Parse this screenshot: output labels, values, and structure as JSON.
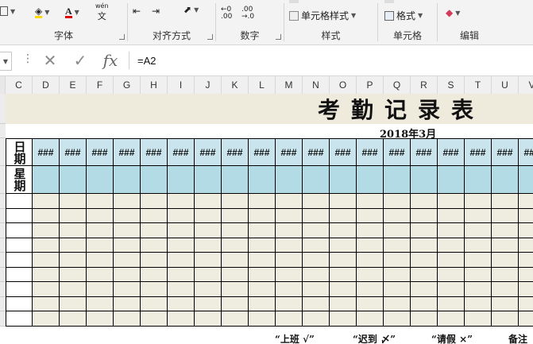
{
  "ribbon": {
    "groups": [
      {
        "label": "字体"
      },
      {
        "label": "对齐方式"
      },
      {
        "label": "数字"
      },
      {
        "label": "样式"
      },
      {
        "label": "单元格"
      },
      {
        "label": "编辑"
      }
    ],
    "phonetic_label": "wén",
    "phonetic_char": "文",
    "cell_styles_label": "单元格样式",
    "format_label": "格式",
    "number_inc": "←0\n.00",
    "number_dec": ".00\n→.0"
  },
  "formula_bar": {
    "namebox_caret": "▼",
    "fx": "fx",
    "cancel": "✕",
    "enter": "✓",
    "formula": "=A2"
  },
  "columns": [
    "C",
    "D",
    "E",
    "F",
    "G",
    "H",
    "I",
    "J",
    "K",
    "L",
    "M",
    "N",
    "O",
    "P",
    "Q",
    "R",
    "S",
    "T",
    "U",
    "V"
  ],
  "sheet": {
    "title": "考勤记录表",
    "subtitle": "2018年3月",
    "row_date_label": "日期",
    "row_week_label": "星期",
    "hash": "###",
    "footer": [
      "“上班 √”",
      "“迟到 〆”",
      "“请假 ×”",
      "备注"
    ]
  },
  "colors": {
    "header_blue": "#c9e4ec",
    "week_blue": "#b3dbe6",
    "body_beige": "#efede0",
    "title_band": "#eeeadc"
  }
}
